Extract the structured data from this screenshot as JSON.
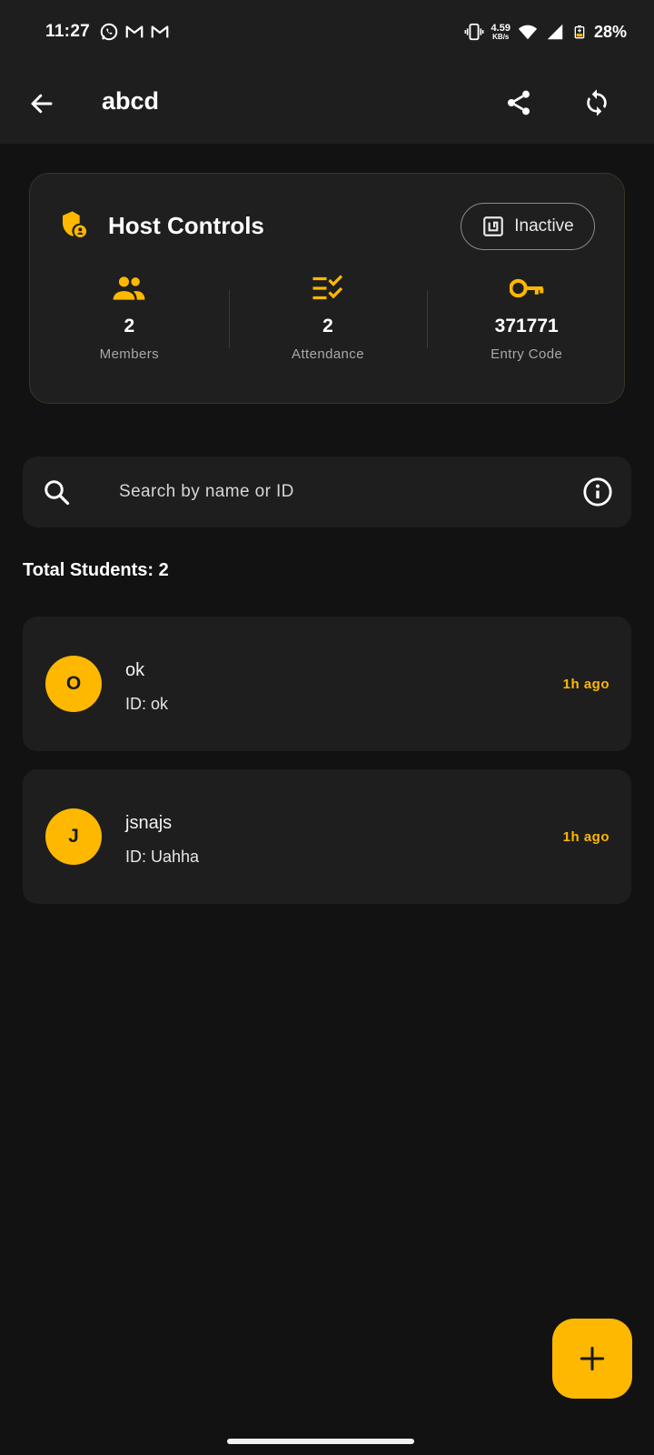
{
  "status_bar": {
    "time": "11:27",
    "net_speed_value": "4.59",
    "net_speed_unit": "KB/s",
    "battery": "28%",
    "notification_icons": [
      "whatsapp-icon",
      "gmail-icon",
      "gmail-icon"
    ]
  },
  "app_bar": {
    "title": "abcd"
  },
  "host_controls": {
    "title": "Host Controls",
    "status_label": "Inactive",
    "stats": [
      {
        "icon": "people-icon",
        "value": "2",
        "label": "Members"
      },
      {
        "icon": "checklist-icon",
        "value": "2",
        "label": "Attendance"
      },
      {
        "icon": "key-icon",
        "value": "371771",
        "label": "Entry Code"
      }
    ]
  },
  "search": {
    "placeholder": "Search by name or ID",
    "value": ""
  },
  "total_students_label": "Total Students: 2",
  "students": [
    {
      "initial": "O",
      "name": "ok",
      "id_label": "ID: ok",
      "time": "1h ago"
    },
    {
      "initial": "J",
      "name": "jsnajs",
      "id_label": "ID: Uahha",
      "time": "1h ago"
    }
  ],
  "colors": {
    "accent": "#ffb800",
    "background": "#121212",
    "surface": "#1e1e1e"
  }
}
